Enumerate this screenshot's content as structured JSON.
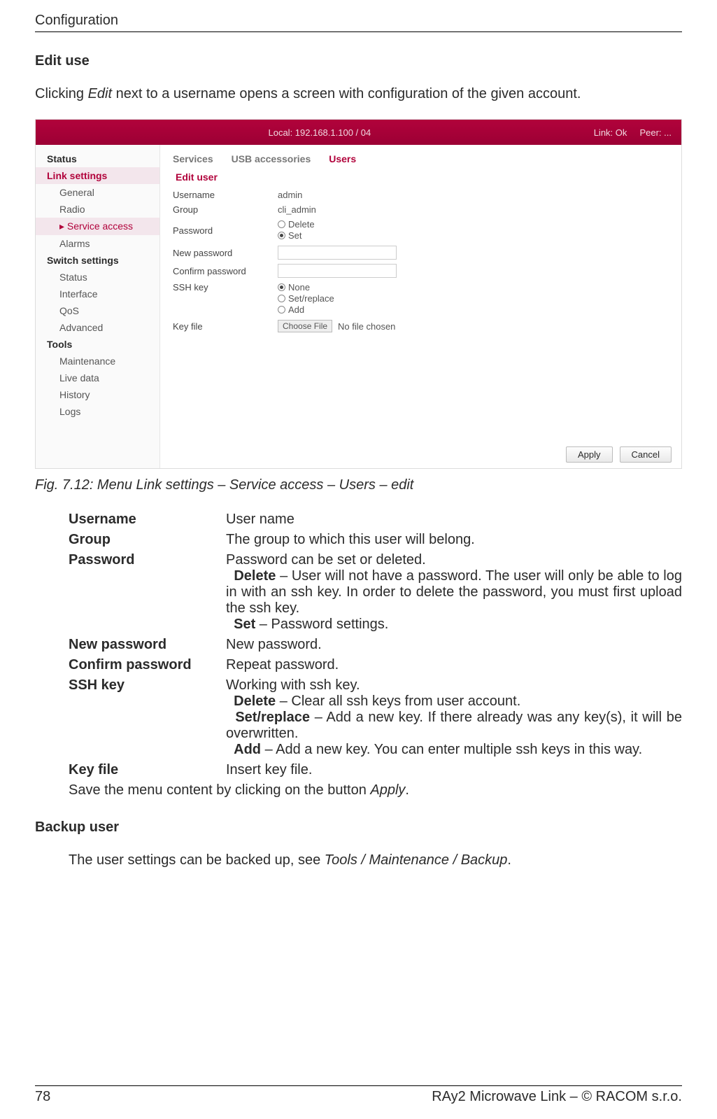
{
  "header": "Configuration",
  "section1_title": "Edit use",
  "intro_pre": "Clicking ",
  "intro_em": "Edit",
  "intro_post": " next to a username opens a screen with configuration of the given account.",
  "shot": {
    "topbar": {
      "left": "",
      "center": "Local: 192.168.1.100 / 04",
      "right_a": "Link: Ok",
      "right_b": "Peer: ..."
    },
    "sidebar": [
      {
        "label": "Status",
        "cls": "group"
      },
      {
        "label": "Link settings",
        "cls": "group active"
      },
      {
        "label": "General",
        "cls": "sub"
      },
      {
        "label": "Radio",
        "cls": "sub"
      },
      {
        "label": "Service access",
        "cls": "sub active",
        "prefix": "▸"
      },
      {
        "label": "Alarms",
        "cls": "sub"
      },
      {
        "label": "Switch settings",
        "cls": "group"
      },
      {
        "label": "Status",
        "cls": "sub"
      },
      {
        "label": "Interface",
        "cls": "sub"
      },
      {
        "label": "QoS",
        "cls": "sub"
      },
      {
        "label": "Advanced",
        "cls": "sub"
      },
      {
        "label": "Tools",
        "cls": "group"
      },
      {
        "label": "Maintenance",
        "cls": "sub"
      },
      {
        "label": "Live data",
        "cls": "sub"
      },
      {
        "label": "History",
        "cls": "sub"
      },
      {
        "label": "Logs",
        "cls": "sub"
      }
    ],
    "tabs": [
      "Services",
      "USB accessories",
      "Users"
    ],
    "active_tab": 2,
    "section_title": "Edit user",
    "rows": {
      "username_lbl": "Username",
      "username_val": "admin",
      "group_lbl": "Group",
      "group_val": "cli_admin",
      "password_lbl": "Password",
      "pw_delete": "Delete",
      "pw_set": "Set",
      "newpw_lbl": "New password",
      "confirm_lbl": "Confirm password",
      "sshkey_lbl": "SSH key",
      "ssh_none": "None",
      "ssh_setreplace": "Set/replace",
      "ssh_add": "Add",
      "keyfile_lbl": "Key file",
      "choose": "Choose File",
      "nofile": "No file chosen"
    },
    "buttons": {
      "apply": "Apply",
      "cancel": "Cancel"
    }
  },
  "caption": "Fig. 7.12: Menu Link settings – Service access – Users – edit",
  "defs": [
    {
      "t": "Username",
      "parts": [
        {
          "txt": "User name"
        }
      ]
    },
    {
      "t": "Group",
      "parts": [
        {
          "txt": "The group to which this user will belong."
        }
      ]
    },
    {
      "t": "Password",
      "parts": [
        {
          "txt": "Password can be set or deleted."
        },
        {
          "br": true
        },
        {
          "indent": true,
          "b": "Delete",
          "txt": " – User will not have a password. The user will only be able to log in with an ssh key. In order to delete the password, you must first upload the ssh key."
        },
        {
          "br": true
        },
        {
          "indent": true,
          "b": "Set",
          "txt": " – Password settings."
        }
      ]
    },
    {
      "t": "New password",
      "parts": [
        {
          "txt": "New password."
        }
      ]
    },
    {
      "t": "Confirm password",
      "parts": [
        {
          "txt": "Repeat password."
        }
      ]
    },
    {
      "t": "SSH key",
      "parts": [
        {
          "txt": "Working with ssh key."
        },
        {
          "br": true
        },
        {
          "indent": true,
          "b": "Delete",
          "txt": " – Clear all ssh keys from user account."
        },
        {
          "br": true
        },
        {
          "indent": true,
          "b": "Set/replace",
          "txt": " – Add a new key. If there already was any key(s), it will be overwritten."
        },
        {
          "br": true
        },
        {
          "indent": true,
          "b": "Add",
          "txt": " – Add a new key. You can enter multiple ssh keys in this way."
        }
      ]
    },
    {
      "t": "Key file",
      "parts": [
        {
          "txt": "Insert key file."
        }
      ]
    }
  ],
  "save_pre": "Save the menu content by clicking on the button ",
  "save_em": "Apply",
  "save_post": ".",
  "section2_title": "Backup user",
  "backup_pre": "The user settings can be backed up, see ",
  "backup_em": "Tools / Maintenance / Backup",
  "backup_post": ".",
  "footer": {
    "page": "78",
    "right": "RAy2 Microwave Link – © RACOM s.r.o."
  }
}
